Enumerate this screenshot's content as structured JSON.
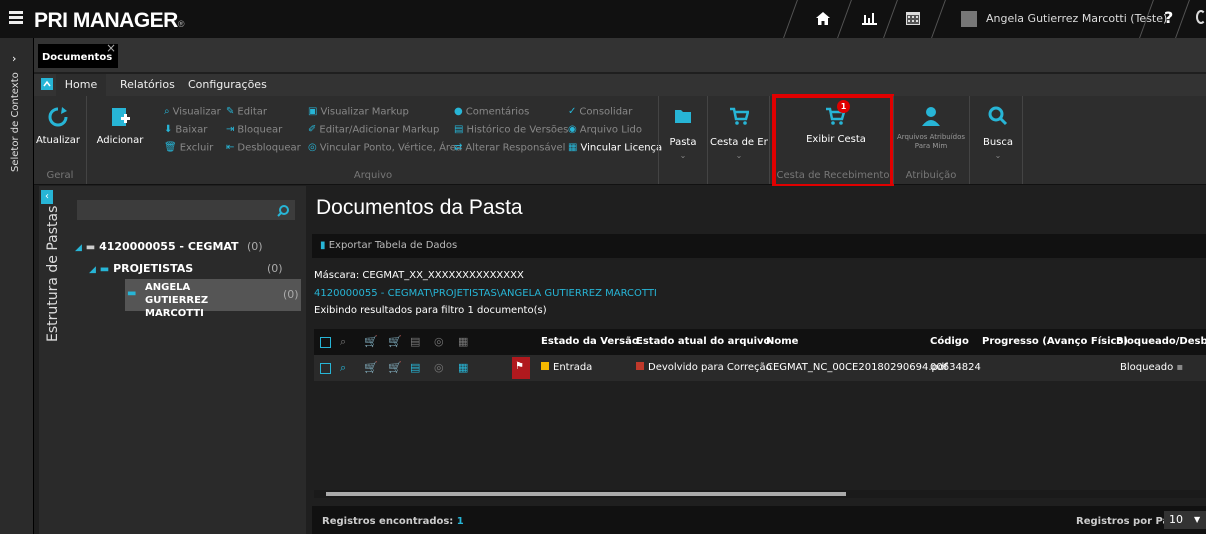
{
  "app": {
    "logo": "PRI MANAGER",
    "user": "Angela Gutierrez Marcotti (Teste)",
    "help": "?",
    "context_selector": "Seletor de Contexto"
  },
  "doc_tab": {
    "label": "Documentos",
    "close": "×"
  },
  "ribbon_tabs": [
    "Home",
    "Relatórios",
    "Configurações"
  ],
  "ribbon": {
    "geral": {
      "atualizar": "Atualizar",
      "label": "Geral"
    },
    "arquivo": {
      "adicionar": "Adicionar",
      "visualizar": "Visualizar",
      "editar": "Editar",
      "baixar": "Baixar",
      "bloquear": "Bloquear",
      "excluir": "Excluir",
      "desbloquear": "Desbloquear",
      "visualizar_markup": "Visualizar Markup",
      "editar_markup": "Editar/Adicionar Markup",
      "vincular_ponto": "Vincular Ponto, Vértice, Área",
      "comentarios": "Comentários",
      "historico": "Histórico de Versões",
      "alterar_responsavel": "Alterar Responsável",
      "consolidar": "Consolidar",
      "arquivo_lido": "Arquivo Lido",
      "vincular_licenca": "Vincular Licença",
      "label": "Arquivo"
    },
    "pasta": "Pasta",
    "cesta_envio": "Cesta de Envi",
    "exibir_cesta": "Exibir Cesta",
    "exibir_cesta_badge": "1",
    "cesta_recebimento_label": "Cesta de Recebimento",
    "arquivos_atribuidos": "Arquivos Atribuídos Para Mim",
    "atribuicao_label": "Atribuição",
    "busca": "Busca"
  },
  "tree": {
    "panel_label": "Estrutura de Pastas",
    "items": [
      {
        "label": "4120000055 - CEGMAT",
        "count": "(0)"
      },
      {
        "label": "PROJETISTAS",
        "count": "(0)"
      },
      {
        "label": "ANGELA GUTIERREZ MARCOTTI",
        "count": "(0)"
      }
    ]
  },
  "content": {
    "title": "Documentos da Pasta",
    "export": "Exportar Tabela de Dados",
    "mask": "Máscara: CEGMAT_XX_XXXXXXXXXXXXXX",
    "path": "4120000055 - CEGMAT\\PROJETISTAS\\ANGELA GUTIERREZ MARCOTTI",
    "filter": "Exibindo resultados para filtro 1 documento(s)",
    "columns": [
      "Estado da Versão",
      "Estado atual do arquivo",
      "Nome",
      "Código",
      "Progresso (Avanço Físico)",
      "Bloqueado/Desbloq"
    ],
    "row": {
      "estado_versao": "Entrada",
      "estado_arquivo": "Devolvido para Correção",
      "nome": "CEGMAT_NC_00CE20180290694.pdf",
      "codigo": "00634824",
      "progresso": "",
      "bloqueado": "Bloqueado"
    },
    "footer_left_label": "Registros encontrados:",
    "footer_left_value": "1",
    "footer_right_label": "Registros por Página",
    "per_page": "10"
  },
  "colors": {
    "accent": "#27b5d6",
    "highlight": "#e00000",
    "entrada": "#f5b800",
    "devolvido": "#c0392b"
  }
}
